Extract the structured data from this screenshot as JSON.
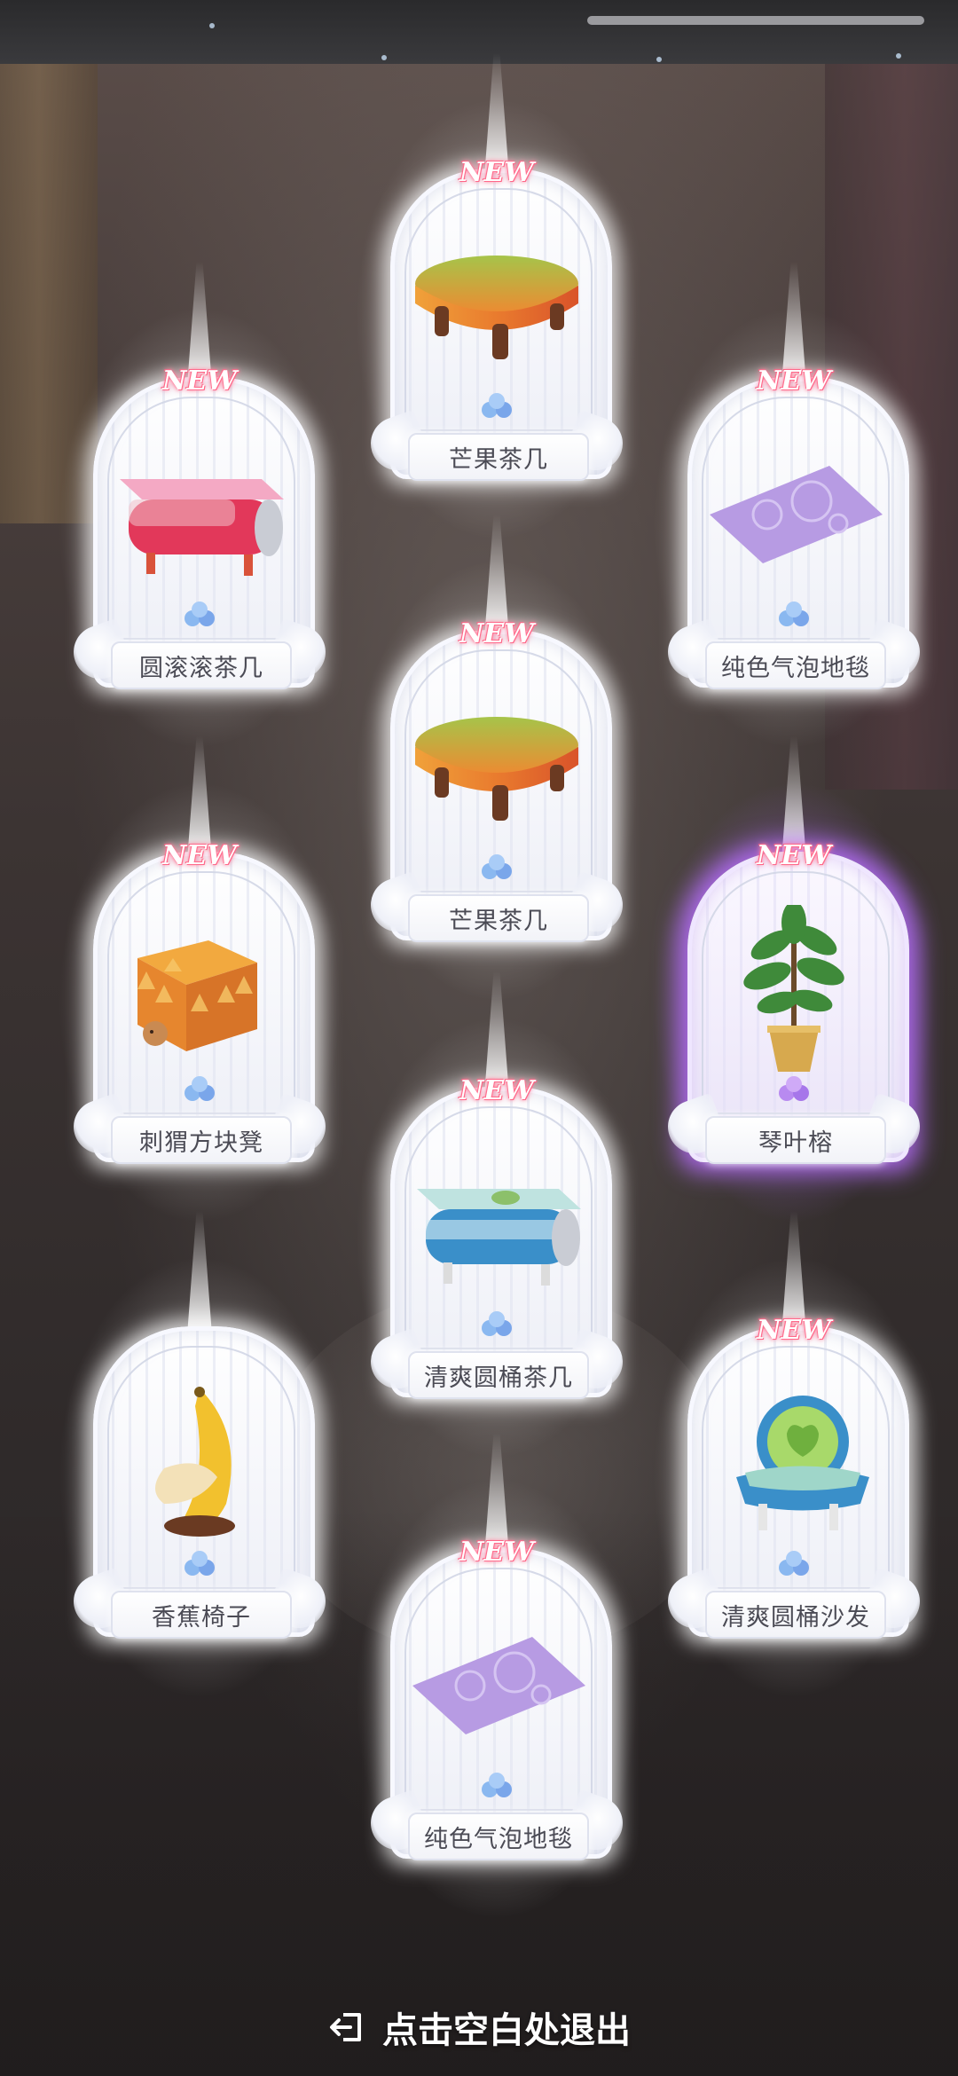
{
  "badges": {
    "new": "NEW"
  },
  "items": [
    {
      "name": "芒果茶几",
      "new": true,
      "rarity": "blue",
      "icon": "mango-coffee-table"
    },
    {
      "name": "圆滚滚茶几",
      "new": true,
      "rarity": "blue",
      "icon": "pink-can-table"
    },
    {
      "name": "纯色气泡地毯",
      "new": true,
      "rarity": "blue",
      "icon": "purple-bubble-rug"
    },
    {
      "name": "芒果茶几",
      "new": true,
      "rarity": "blue",
      "icon": "mango-coffee-table"
    },
    {
      "name": "刺猬方块凳",
      "new": true,
      "rarity": "blue",
      "icon": "hedgehog-cube-stool"
    },
    {
      "name": "琴叶榕",
      "new": true,
      "rarity": "purple",
      "icon": "fiddle-leaf-fig-plant"
    },
    {
      "name": "清爽圆桶茶几",
      "new": true,
      "rarity": "blue",
      "icon": "teal-can-table"
    },
    {
      "name": "香蕉椅子",
      "new": false,
      "rarity": "blue",
      "icon": "banana-chair"
    },
    {
      "name": "清爽圆桶沙发",
      "new": true,
      "rarity": "blue",
      "icon": "teal-can-sofa"
    },
    {
      "name": "纯色气泡地毯",
      "new": true,
      "rarity": "blue",
      "icon": "purple-bubble-rug"
    }
  ],
  "footer": {
    "exit_text": "点击空白处退出",
    "exit_icon": "exit-arrow-icon"
  },
  "colors": {
    "new_badge": "#ff5a7e",
    "rarity_blue": "#7fb0ee",
    "rarity_purple": "#b46cff"
  }
}
